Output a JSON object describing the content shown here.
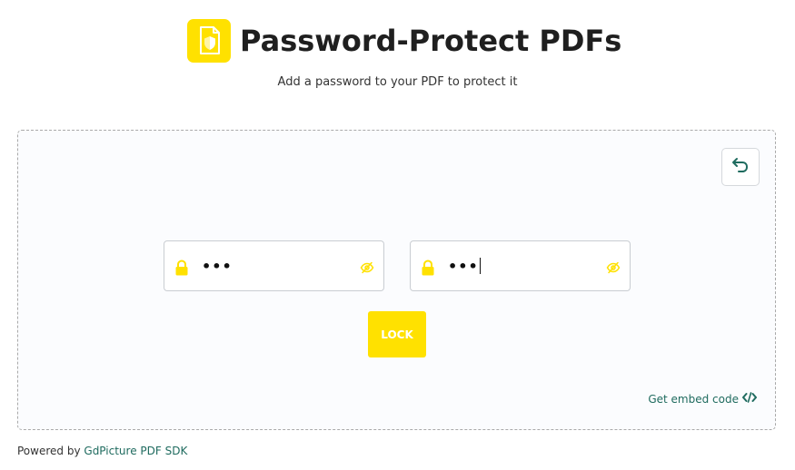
{
  "header": {
    "title": "Password-Protect PDFs",
    "subtitle": "Add a password to your PDF to protect it",
    "logo_icon": "pdf-shield-icon"
  },
  "tool": {
    "reset_icon": "undo-icon",
    "password_fields": [
      {
        "masked_value": "•••",
        "lock_icon": "lock-icon",
        "toggle_icon": "eye-off-icon"
      },
      {
        "masked_value": "•••",
        "lock_icon": "lock-icon",
        "toggle_icon": "eye-off-icon",
        "focused": true
      }
    ],
    "lock_button": "LOCK",
    "embed_link": "Get embed code",
    "embed_icon": "code-icon"
  },
  "footer": {
    "prefix": "Powered by",
    "link": "GdPicture PDF SDK"
  },
  "colors": {
    "accent_yellow": "#ffe100",
    "link_teal": "#1f6b5f",
    "panel_background": "#fbfcfe",
    "panel_border": "#a9a9a9"
  }
}
